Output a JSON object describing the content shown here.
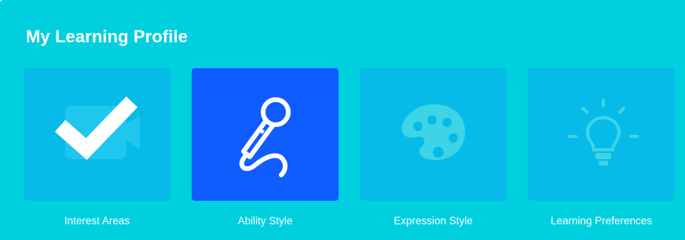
{
  "page": {
    "title": "My Learning Profile"
  },
  "colors": {
    "panel_background": "#00d0de",
    "card_background": "#06bbe8",
    "card_selected_background": "#0f5cff",
    "icon_muted": "#3dd5e6",
    "text": "#ffffff"
  },
  "cards": [
    {
      "label": "Interest Areas",
      "icon": "checkmark-icon",
      "selected": false
    },
    {
      "label": "Ability Style",
      "icon": "microphone-icon",
      "selected": true
    },
    {
      "label": "Expression Style",
      "icon": "palette-icon",
      "selected": false
    },
    {
      "label": "Learning Preferences",
      "icon": "lightbulb-icon",
      "selected": false
    }
  ]
}
